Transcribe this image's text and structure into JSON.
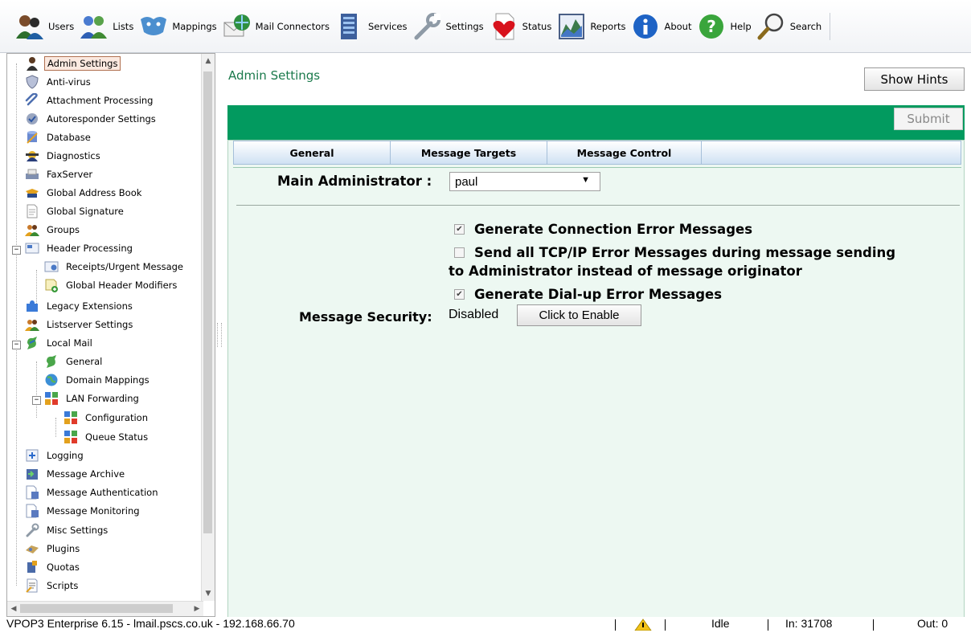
{
  "toolbar": {
    "items": [
      {
        "label": "Users",
        "icon": "users-icon"
      },
      {
        "label": "Lists",
        "icon": "lists-icon"
      },
      {
        "label": "Mappings",
        "icon": "mappings-icon"
      },
      {
        "label": "Mail Connectors",
        "icon": "mail-connectors-icon"
      },
      {
        "label": "Services",
        "icon": "services-icon"
      },
      {
        "label": "Settings",
        "icon": "settings-icon"
      },
      {
        "label": "Status",
        "icon": "status-icon"
      },
      {
        "label": "Reports",
        "icon": "reports-icon"
      },
      {
        "label": "About",
        "icon": "about-icon"
      },
      {
        "label": "Help",
        "icon": "help-icon"
      },
      {
        "label": "Search",
        "icon": "search-icon"
      }
    ]
  },
  "tree": {
    "items": [
      {
        "label": "Admin Settings",
        "selected": true
      },
      {
        "label": "Anti-virus"
      },
      {
        "label": "Attachment Processing"
      },
      {
        "label": "Autoresponder Settings"
      },
      {
        "label": "Database"
      },
      {
        "label": "Diagnostics"
      },
      {
        "label": "FaxServer"
      },
      {
        "label": "Global Address Book"
      },
      {
        "label": "Global Signature"
      },
      {
        "label": "Groups"
      },
      {
        "label": "Header Processing",
        "expanded": true
      },
      {
        "label": "Receipts/Urgent Message"
      },
      {
        "label": "Global Header Modifiers"
      },
      {
        "label": "Legacy Extensions"
      },
      {
        "label": "Listserver Settings"
      },
      {
        "label": "Local Mail",
        "expanded": true
      },
      {
        "label": "General"
      },
      {
        "label": "Domain Mappings"
      },
      {
        "label": "LAN Forwarding",
        "expanded": true
      },
      {
        "label": "Configuration"
      },
      {
        "label": "Queue Status"
      },
      {
        "label": "Logging"
      },
      {
        "label": "Message Archive"
      },
      {
        "label": "Message Authentication"
      },
      {
        "label": "Message Monitoring"
      },
      {
        "label": "Misc Settings"
      },
      {
        "label": "Plugins"
      },
      {
        "label": "Quotas"
      },
      {
        "label": "Scripts"
      }
    ]
  },
  "main": {
    "title": "Admin Settings",
    "show_hints_label": "Show Hints",
    "submit_label": "Submit",
    "tabs": [
      {
        "label": "General",
        "active": true
      },
      {
        "label": "Message Targets"
      },
      {
        "label": "Message Control"
      }
    ],
    "form": {
      "main_admin_label": "Main Administrator :",
      "main_admin_value": "paul",
      "gen_conn_error_label": "Generate Connection Error Messages",
      "gen_conn_error_checked": true,
      "send_tcpip_label_line1": "Send all TCP/IP Error Messages during message sending",
      "send_tcpip_label_line2": "to Administrator instead of message originator",
      "send_tcpip_checked": false,
      "gen_dialup_label": "Generate Dial-up Error Messages",
      "gen_dialup_checked": true,
      "msg_security_label": "Message Security:",
      "msg_security_value": "Disabled",
      "enable_button_label": "Click to Enable"
    }
  },
  "statusbar": {
    "app_info": "VPOP3 Enterprise 6.15 - lmail.pscs.co.uk - 192.168.66.70",
    "warning_icon": "warning-icon",
    "state": "Idle",
    "in_count": "In: 31708",
    "out_count": "Out: 0"
  },
  "colors": {
    "accent_green": "#029a5f",
    "title_green": "#1b7a4c",
    "panel_bg": "#edf8f2"
  }
}
